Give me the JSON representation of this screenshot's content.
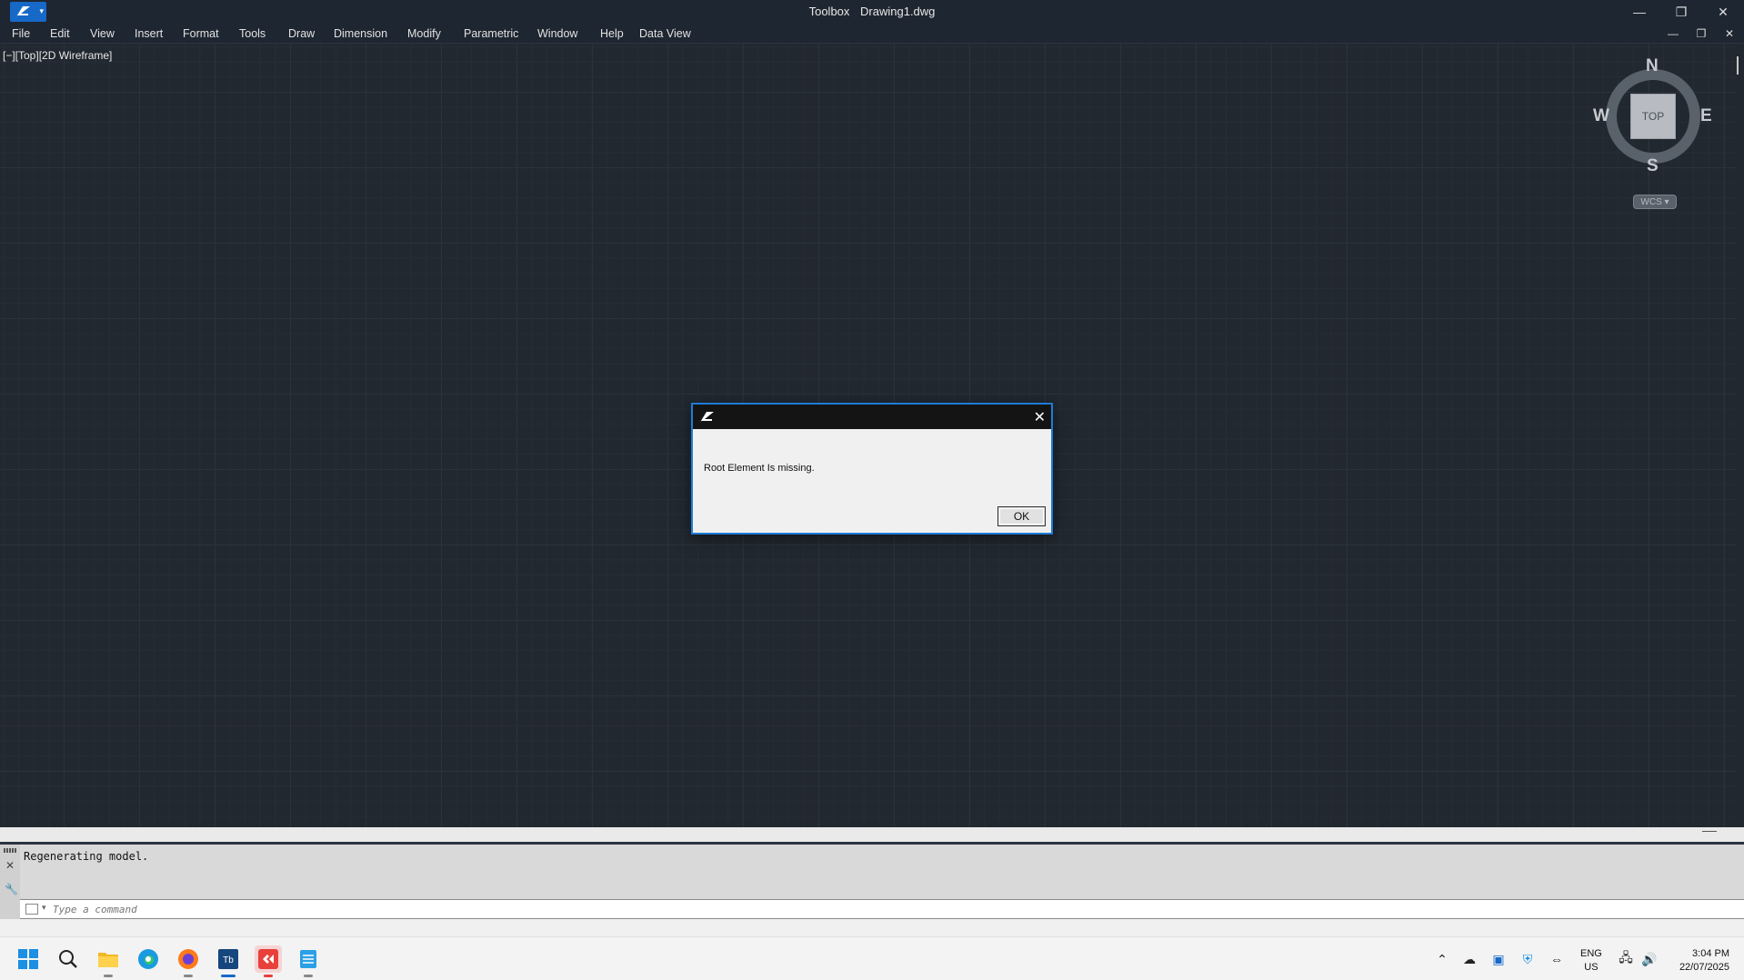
{
  "titlebar": {
    "app_name": "Toolbox",
    "document": "Drawing1.dwg",
    "minimize_glyph": "—",
    "restore_glyph": "❐",
    "close_glyph": "✕"
  },
  "menu": {
    "items": [
      "File",
      "Edit",
      "View",
      "Insert",
      "Format",
      "Tools",
      "Draw",
      "Dimension",
      "Modify",
      "Parametric",
      "Window",
      "Help",
      "Data View"
    ]
  },
  "viewport": {
    "label": "[−][Top][2D Wireframe]"
  },
  "viewcube": {
    "top_face": "TOP",
    "north": "N",
    "south": "S",
    "east": "E",
    "west": "W",
    "wcs_label": "WCS ▾"
  },
  "dialog": {
    "message": "Root Element Is missing.",
    "ok_label": "OK",
    "close_glyph": "✕"
  },
  "command": {
    "history": "Regenerating model.",
    "placeholder": "Type a command"
  },
  "taskbar": {
    "language_line1": "ENG",
    "language_line2": "US",
    "time": "3:04 PM",
    "date": "22/07/2025"
  },
  "colors": {
    "canvas_bg": "#212830",
    "dialog_border": "#1e7cd6",
    "app_logo": "#1769c8"
  }
}
